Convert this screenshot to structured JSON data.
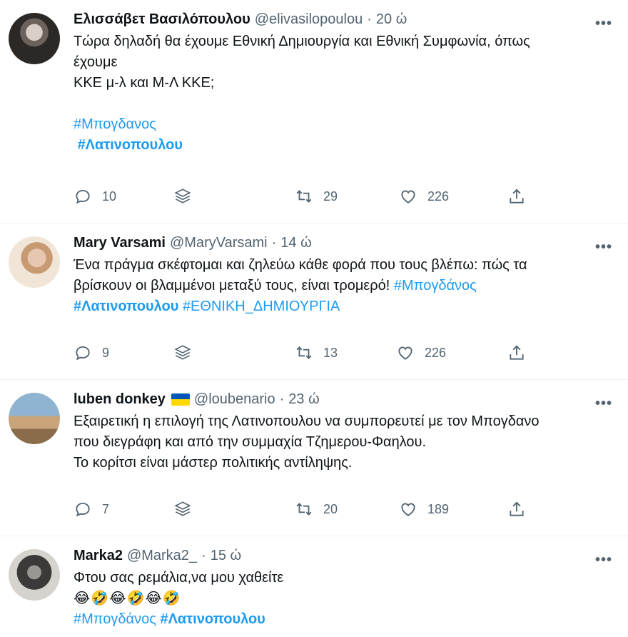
{
  "tweets": [
    {
      "name": "Ελισσάβετ Βασιλόπουλου",
      "handle": "@elivasilopoulou",
      "time": "20 ώ",
      "lines": [
        "Τώρα δηλαδή θα έχουμε Εθνική Δημιουργία και Εθνική Συμφωνία, όπως",
        "έχουμε",
        "ΚΚΕ μ-λ και Μ-Λ ΚΚΕ;"
      ],
      "tag1": "#Μπογδανος",
      "tag2": "#Λατινοπουλου",
      "replies": "10",
      "retweets": "29",
      "likes": "226"
    },
    {
      "name": "Mary Varsami",
      "handle": "@MaryVarsami",
      "time": "14 ώ",
      "line1": "Ένα πράγμα σκέφτομαι και ζηλεύω κάθε φορά που τους βλέπω: πώς τα",
      "line2": "βρίσκουν οι βλαμμένοι μεταξύ τους, είναι τρομερό! ",
      "tag1": "#Μπογδάνος",
      "tag2": "#Λατινοπουλου",
      "tag3": "#ΕΘΝΙΚΗ_ΔΗΜΙΟΥΡΓΙΑ",
      "replies": "9",
      "retweets": "13",
      "likes": "226"
    },
    {
      "name": "luben donkey",
      "handle": "@loubenario",
      "time": "23 ώ",
      "lines": [
        "Εξαιρετική η επιλογή της Λατινοπουλου να συμπορευτεί με τον Μπογδανο",
        "που διεγράφη και από την συμμαχία Τζημερου-Φαηλου.",
        "Το κορίτσι είναι μάστερ πολιτικής αντίληψης."
      ],
      "replies": "7",
      "retweets": "20",
      "likes": "189"
    },
    {
      "name": "Marka2",
      "handle": "@Marka2_",
      "time": "15 ώ",
      "line1": "Φτου σας ρεμάλια,να μου χαθείτε",
      "emojis": "😂🤣😂🤣😂🤣",
      "tag1": "#Μπογδάνος",
      "tag2": "#Λατινοπουλου"
    }
  ],
  "ui": {
    "dot": "·",
    "more": "•••"
  },
  "colors": {
    "link": "#1d9bf0",
    "secondary": "#536471",
    "flag_blue": "#0057b7",
    "flag_yellow": "#ffd700"
  }
}
